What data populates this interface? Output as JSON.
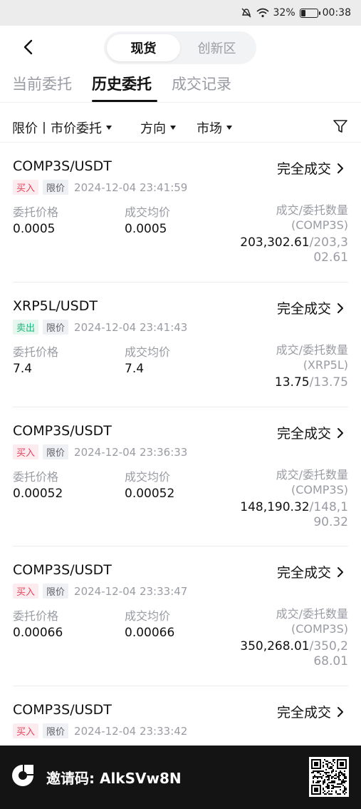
{
  "status_bar": {
    "battery_percent": "32%",
    "battery_level": 0.32,
    "time": "00:38",
    "icons": [
      "mute-icon",
      "wifi-icon",
      "battery-icon"
    ]
  },
  "nav": {
    "back_icon": "chevron-left-icon",
    "segments": [
      "现货",
      "创新区"
    ],
    "active_segment": 0
  },
  "tabs": [
    "当前委托",
    "历史委托",
    "成交记录"
  ],
  "active_tab": 1,
  "filters": {
    "order_type": "限价丨市价委托",
    "direction": "方向",
    "market": "市场",
    "filter_icon": "funnel-icon"
  },
  "labels": {
    "order_price": "委托价格",
    "avg_price": "成交均价",
    "qty": "成交/委托数量"
  },
  "orders": [
    {
      "symbol": "COMP3S/USDT",
      "status": "完全成交",
      "side": "买入",
      "type": "限价",
      "time": "2024-12-04 23:41:59",
      "order_price": "0.0005",
      "avg_price": "0.0005",
      "unit": "(COMP3S)",
      "filled": "203,302.61",
      "total": "/203,302.61"
    },
    {
      "symbol": "XRP5L/USDT",
      "status": "完全成交",
      "side": "卖出",
      "type": "限价",
      "time": "2024-12-04 23:41:43",
      "order_price": "7.4",
      "avg_price": "7.4",
      "unit": "(XRP5L)",
      "filled": "13.75",
      "total": "/13.75"
    },
    {
      "symbol": "COMP3S/USDT",
      "status": "完全成交",
      "side": "买入",
      "type": "限价",
      "time": "2024-12-04 23:36:33",
      "order_price": "0.00052",
      "avg_price": "0.00052",
      "unit": "(COMP3S)",
      "filled": "148,190.32",
      "total": "/148,190.32"
    },
    {
      "symbol": "COMP3S/USDT",
      "status": "完全成交",
      "side": "买入",
      "type": "限价",
      "time": "2024-12-04 23:33:47",
      "order_price": "0.00066",
      "avg_price": "0.00066",
      "unit": "(COMP3S)",
      "filled": "350,268.01",
      "total": "/350,268.01"
    },
    {
      "symbol": "COMP3S/USDT",
      "status": "完全成交",
      "side": "买入",
      "type": "限价",
      "time": "2024-12-04 23:33:42"
    }
  ],
  "invite": {
    "text": "邀请码: AlkSVw8N",
    "logo_icon": "brand-logo-icon",
    "qr_icon": "qr-code-icon"
  },
  "colors": {
    "buy": "#e0445c",
    "sell": "#1fb57c",
    "muted": "#9a9ca3",
    "invite_bg": "#141414"
  }
}
